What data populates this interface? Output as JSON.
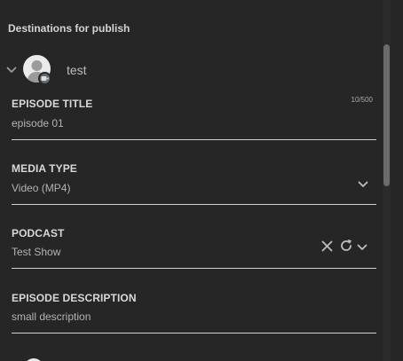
{
  "heading": "Destinations for publish",
  "account": {
    "name": "test",
    "avatar_icon": "user-avatar-icon",
    "badge_icon": "video-camera-icon"
  },
  "fields": {
    "episode_title": {
      "label": "EPISODE TITLE",
      "value": "episode 01",
      "counter": "10/500"
    },
    "media_type": {
      "label": "MEDIA TYPE",
      "value": "Video (MP4)"
    },
    "podcast": {
      "label": "PODCAST",
      "value": "Test Show"
    },
    "episode_description": {
      "label": "EPISODE DESCRIPTION",
      "value": "small description"
    }
  },
  "colors": {
    "background": "#262626",
    "label": "#d8d8d8",
    "value": "#b3b3b3",
    "underline": "#d0d0d0"
  }
}
